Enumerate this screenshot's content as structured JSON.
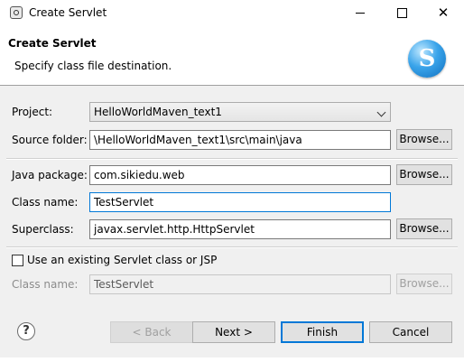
{
  "window": {
    "title": "Create Servlet",
    "minimize_glyph": "",
    "maximize_glyph": "",
    "close_glyph": "✕"
  },
  "header": {
    "title": "Create Servlet",
    "subtitle": "Specify class file destination.",
    "logo_glyph": "S"
  },
  "form": {
    "project": {
      "label": "Project:",
      "value": "HelloWorldMaven_text1"
    },
    "source_folder": {
      "label": "Source folder:",
      "value": "\\HelloWorldMaven_text1\\src\\main\\java",
      "browse": "Browse..."
    },
    "java_package": {
      "label": "Java package:",
      "value": "com.sikiedu.web",
      "browse": "Browse..."
    },
    "class_name": {
      "label": "Class name:",
      "value": "TestServlet"
    },
    "superclass": {
      "label": "Superclass:",
      "value": "javax.servlet.http.HttpServlet",
      "browse": "Browse..."
    },
    "use_existing": {
      "label": "Use an existing Servlet class or JSP",
      "checked": false
    },
    "existing_class_name": {
      "label": "Class name:",
      "value": "TestServlet",
      "browse": "Browse..."
    }
  },
  "footer": {
    "help_glyph": "?",
    "back": "< Back",
    "next": "Next >",
    "finish": "Finish",
    "cancel": "Cancel"
  },
  "colors": {
    "accent": "#0078d7",
    "dialog_bg": "#f0f0f0"
  }
}
